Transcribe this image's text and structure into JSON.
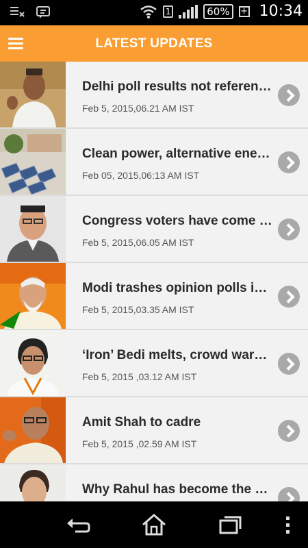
{
  "status_bar": {
    "battery": "60%",
    "sim": "1",
    "time": "10:34"
  },
  "header": {
    "title": "LATEST UPDATES",
    "menu_icon": "hamburger-menu-icon"
  },
  "articles": [
    {
      "headline": "Delhi poll results not referend...",
      "date": "Feb 5, 2015,06.21 AM IST"
    },
    {
      "headline": "Clean power, alternative energ...",
      "date": "Feb 05, 2015,06:13 AM IST"
    },
    {
      "headline": "Congress voters have come b...",
      "date": "Feb 5, 2015,06.05 AM IST"
    },
    {
      "headline": "Modi trashes opinion polls in l...",
      "date": "Feb 5, 2015,03.35 AM IST"
    },
    {
      "headline": "‘Iron’ Bedi melts, crowd warm...",
      "date": "Feb 5, 2015 ,03.12 AM IST"
    },
    {
      "headline": "Amit Shah to cadre",
      "date": "Feb 5, 2015 ,02.59 AM IST"
    },
    {
      "headline": "Why Rahul has become the BJ...",
      "date": ""
    }
  ],
  "nav": {
    "back_icon": "back-icon",
    "home_icon": "home-icon",
    "recents_icon": "recent-apps-icon",
    "overflow_icon": "overflow-menu-icon"
  },
  "colors": {
    "header_bg": "#fa9d33",
    "list_bg": "#f2f2f2",
    "chevron": "#a9a9a9"
  }
}
